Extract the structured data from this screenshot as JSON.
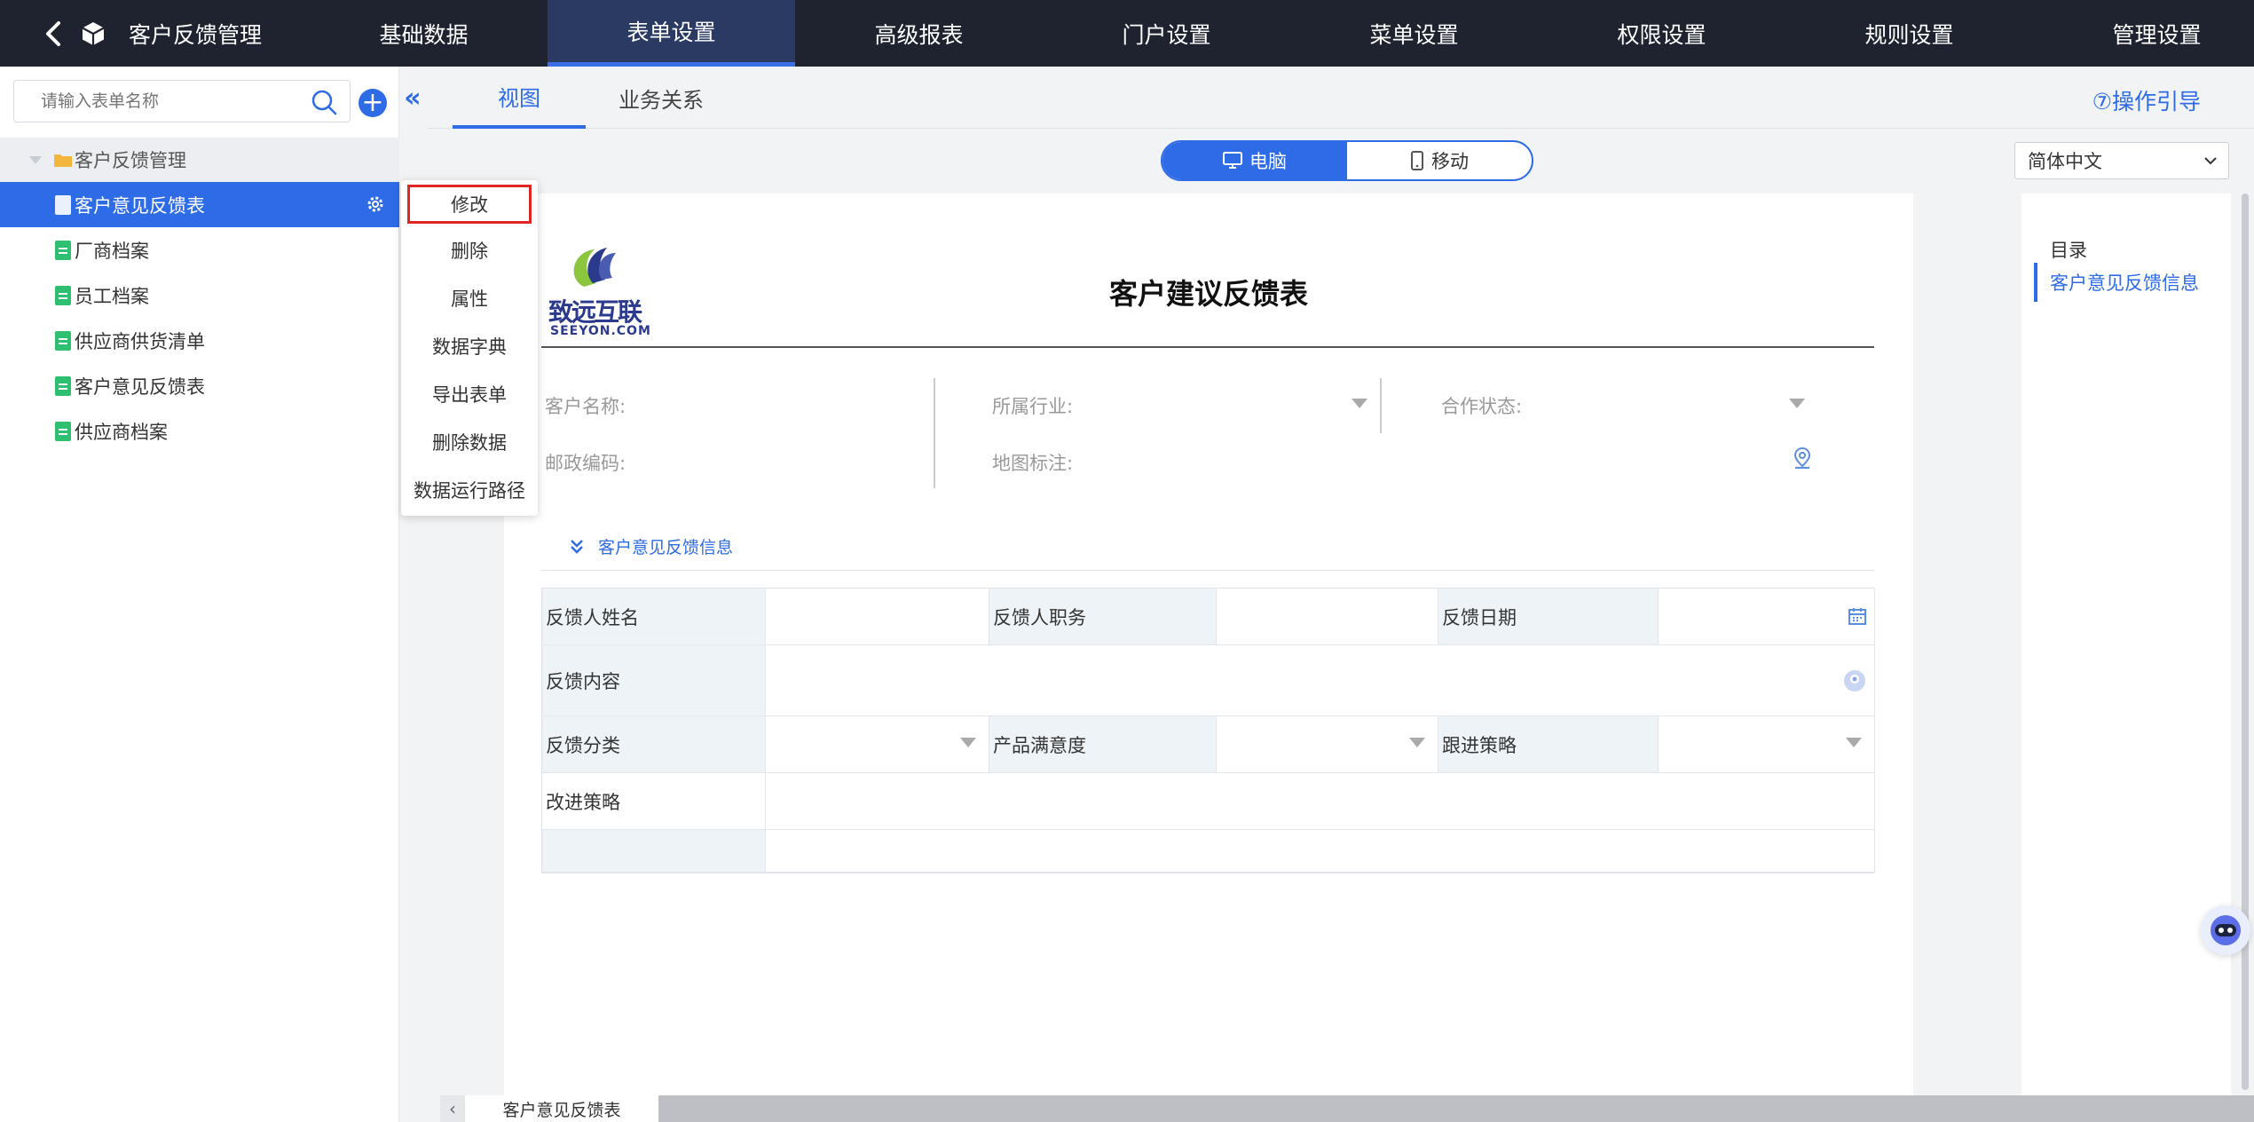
{
  "app": {
    "title": "客户反馈管理",
    "back_icon": "chevron-left-icon",
    "app_icon": "cube-icon"
  },
  "topnav": [
    {
      "label": "基础数据",
      "active": false
    },
    {
      "label": "表单设置",
      "active": true
    },
    {
      "label": "高级报表",
      "active": false
    },
    {
      "label": "门户设置",
      "active": false
    },
    {
      "label": "菜单设置",
      "active": false
    },
    {
      "label": "权限设置",
      "active": false
    },
    {
      "label": "规则设置",
      "active": false
    },
    {
      "label": "管理设置",
      "active": false
    }
  ],
  "sidebar": {
    "search_placeholder": "请输入表单名称",
    "add_label": "+",
    "root": "客户反馈管理",
    "items": [
      {
        "label": "客户意见反馈表",
        "active": true
      },
      {
        "label": "厂商档案",
        "active": false
      },
      {
        "label": "员工档案",
        "active": false
      },
      {
        "label": "供应商供货清单",
        "active": false
      },
      {
        "label": "客户意见反馈表",
        "active": false
      },
      {
        "label": "供应商档案",
        "active": false
      }
    ]
  },
  "collapse_label": "«",
  "context_menu": [
    "修改",
    "删除",
    "属性",
    "数据字典",
    "导出表单",
    "删除数据",
    "数据运行路径"
  ],
  "tabs": {
    "items": [
      "视图",
      "业务关系"
    ],
    "guide": "⑦操作引导"
  },
  "device_toggle": {
    "pc": "电脑",
    "mobile": "移动"
  },
  "language": "简体中文",
  "form": {
    "logo_cn": "致远互联",
    "logo_en": "SEEYON.COM",
    "title": "客户建议反馈表",
    "fields": {
      "customer_name": "客户名称:",
      "industry": "所属行业:",
      "coop_status": "合作状态:",
      "postcode": "邮政编码:",
      "map_mark": "地图标注:"
    },
    "section": "客户意见反馈信息",
    "grid": {
      "feedback_name": "反馈人姓名",
      "feedback_title": "反馈人职务",
      "feedback_date": "反馈日期",
      "feedback_content": "反馈内容",
      "feedback_category": "反馈分类",
      "satisfaction": "产品满意度",
      "followup": "跟进策略",
      "improvement": "改进策略"
    }
  },
  "toc": {
    "head": "目录",
    "item": "客户意见反馈信息"
  },
  "bottom": {
    "sheet": "客户意见反馈表",
    "arrow": "‹"
  },
  "colors": {
    "primary": "#2e6be6",
    "topbar": "#1f2330",
    "highlight_border": "#e02525",
    "doc_icon_green": "#2fbf71",
    "folder_yellow": "#f3b63c"
  }
}
